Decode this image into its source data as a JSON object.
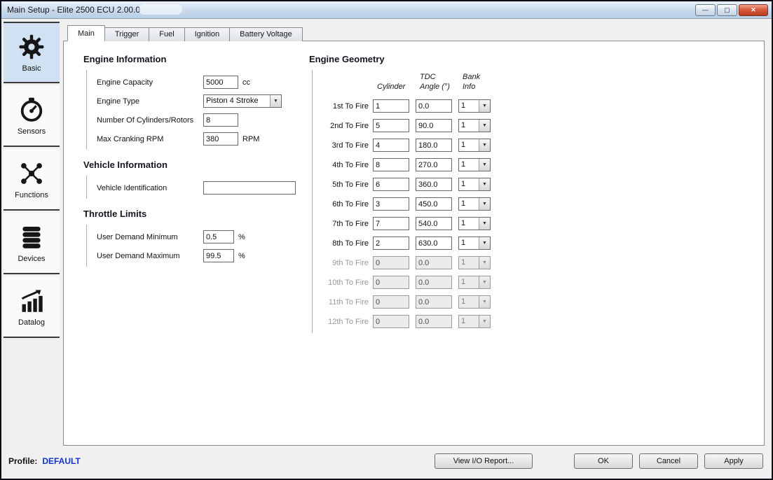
{
  "window": {
    "title": "Main Setup - Elite 2500 ECU 2.00.0",
    "controls": {
      "minimize": "—",
      "maximize": "▢",
      "close": "✕"
    }
  },
  "icons": {
    "dropdown": "▼"
  },
  "colors": {
    "sidebar_active": "#cfe1f3",
    "profile_blue": "#1133cc",
    "close_red": "#b93d22"
  },
  "sidebar": {
    "items": [
      {
        "label": "Basic",
        "icon": "gear-icon",
        "active": true
      },
      {
        "label": "Sensors",
        "icon": "gauge-icon",
        "active": false
      },
      {
        "label": "Functions",
        "icon": "network-icon",
        "active": false
      },
      {
        "label": "Devices",
        "icon": "stack-icon",
        "active": false
      },
      {
        "label": "Datalog",
        "icon": "bar-chart-icon",
        "active": false
      }
    ]
  },
  "tabs": {
    "items": [
      {
        "label": "Main",
        "active": true
      },
      {
        "label": "Trigger",
        "active": false
      },
      {
        "label": "Fuel",
        "active": false
      },
      {
        "label": "Ignition",
        "active": false
      },
      {
        "label": "Battery Voltage",
        "active": false
      }
    ]
  },
  "engine_information": {
    "title": "Engine Information",
    "capacity": {
      "label": "Engine Capacity",
      "value": "5000",
      "unit": "cc"
    },
    "type": {
      "label": "Engine Type",
      "value": "Piston 4 Stroke"
    },
    "cylinders": {
      "label": "Number Of Cylinders/Rotors",
      "value": "8"
    },
    "cranking": {
      "label": "Max Cranking RPM",
      "value": "380",
      "unit": "RPM"
    }
  },
  "vehicle_information": {
    "title": "Vehicle Information",
    "vin": {
      "label": "Vehicle Identification",
      "value": ""
    }
  },
  "throttle_limits": {
    "title": "Throttle Limits",
    "min": {
      "label": "User Demand Minimum",
      "value": "0.5",
      "unit": "%"
    },
    "max": {
      "label": "User Demand Maximum",
      "value": "99.5",
      "unit": "%"
    }
  },
  "engine_geometry": {
    "title": "Engine Geometry",
    "headers": {
      "cylinder": "Cylinder",
      "tdc": "TDC\nAngle (°)",
      "bank": "Bank Info"
    },
    "rows": [
      {
        "label": "1st To Fire",
        "cylinder": "1",
        "tdc": "0.0",
        "bank": "1",
        "disabled": false
      },
      {
        "label": "2nd To Fire",
        "cylinder": "5",
        "tdc": "90.0",
        "bank": "1",
        "disabled": false
      },
      {
        "label": "3rd To Fire",
        "cylinder": "4",
        "tdc": "180.0",
        "bank": "1",
        "disabled": false
      },
      {
        "label": "4th To Fire",
        "cylinder": "8",
        "tdc": "270.0",
        "bank": "1",
        "disabled": false
      },
      {
        "label": "5th To Fire",
        "cylinder": "6",
        "tdc": "360.0",
        "bank": "1",
        "disabled": false
      },
      {
        "label": "6th To Fire",
        "cylinder": "3",
        "tdc": "450.0",
        "bank": "1",
        "disabled": false
      },
      {
        "label": "7th To Fire",
        "cylinder": "7",
        "tdc": "540.0",
        "bank": "1",
        "disabled": false
      },
      {
        "label": "8th To Fire",
        "cylinder": "2",
        "tdc": "630.0",
        "bank": "1",
        "disabled": false
      },
      {
        "label": "9th To Fire",
        "cylinder": "0",
        "tdc": "0.0",
        "bank": "1",
        "disabled": true
      },
      {
        "label": "10th To Fire",
        "cylinder": "0",
        "tdc": "0.0",
        "bank": "1",
        "disabled": true
      },
      {
        "label": "11th To Fire",
        "cylinder": "0",
        "tdc": "0.0",
        "bank": "1",
        "disabled": true
      },
      {
        "label": "12th To Fire",
        "cylinder": "0",
        "tdc": "0.0",
        "bank": "1",
        "disabled": true
      }
    ]
  },
  "footer": {
    "profile_label": "Profile:",
    "profile_value": "DEFAULT",
    "view_report": "View I/O Report...",
    "ok": "OK",
    "cancel": "Cancel",
    "apply": "Apply"
  }
}
